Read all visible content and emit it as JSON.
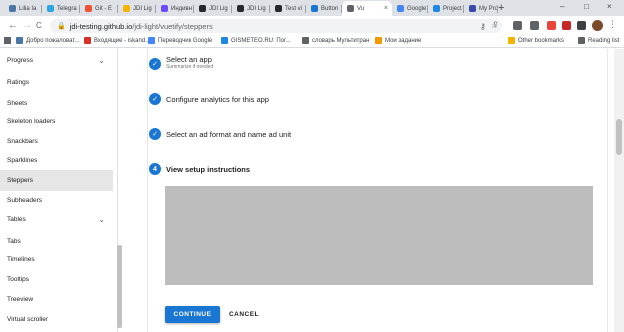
{
  "browser": {
    "tabs": [
      {
        "title": "Lilia Ia",
        "color": "#4a76a8"
      },
      {
        "title": "Telegra",
        "color": "#2ca5e0"
      },
      {
        "title": "Git - E",
        "color": "#f05133"
      },
      {
        "title": "JDI Lig",
        "color": "#f4b400"
      },
      {
        "title": "Индивн",
        "color": "#6d4aff"
      },
      {
        "title": "JDI Lig",
        "color": "#24292e"
      },
      {
        "title": "JDI Lig",
        "color": "#24292e"
      },
      {
        "title": "Test vi",
        "color": "#24292e"
      },
      {
        "title": "Button",
        "color": "#1976d2"
      },
      {
        "title": "Vu",
        "color": "#5f6368",
        "active": true
      },
      {
        "title": "Google",
        "color": "#4285f4"
      },
      {
        "title": "Project",
        "color": "#1e88e5"
      },
      {
        "title": "My Pro",
        "color": "#3949ab"
      }
    ],
    "new_tab": "+",
    "close": "×",
    "url_host": "jdi-testing.github.io",
    "url_path": "/jdi-light/vuetify/steppers",
    "back": "←",
    "forward": "→",
    "reload": "C",
    "lock": "🔒",
    "key_icon": "⚷",
    "share_icon": "⇪",
    "star_icon": "☆",
    "extensions": [
      "#5f6368",
      "#5f6368",
      "#e8453c",
      "#c62828",
      "#3c4043",
      "#5f6368"
    ],
    "win_min": "–",
    "win_max": "□",
    "win_close": "×",
    "menu": "⋮"
  },
  "bookmarks": [
    {
      "label": "Добро пожаловат...",
      "color": "#4a76a8"
    },
    {
      "label": "Входящие - iskand...",
      "color": "#d93025"
    },
    {
      "label": "Переводчик Google",
      "color": "#4285f4"
    },
    {
      "label": "GISMETEO.RU: Пог...",
      "color": "#1e88e5"
    },
    {
      "label": "словарь Мультитран",
      "color": "#5f6368"
    },
    {
      "label": "Мои задание",
      "color": "#f29900"
    },
    {
      "label": "Other bookmarks",
      "color": "#f4b400"
    },
    {
      "label": "Reading list",
      "color": "#5f6368"
    }
  ],
  "sidebar": {
    "items": [
      {
        "label": "Progress",
        "chevron": "⌄"
      },
      {
        "label": "Ratings"
      },
      {
        "label": "Sheets"
      },
      {
        "label": "Skeleton loaders"
      },
      {
        "label": "Snackbars"
      },
      {
        "label": "Sparklines"
      },
      {
        "label": "Steppers",
        "active": true
      },
      {
        "label": "Subheaders"
      },
      {
        "label": "Tables",
        "chevron": "⌄"
      },
      {
        "label": "Tabs"
      },
      {
        "label": "Timelines"
      },
      {
        "label": "Tooltips"
      },
      {
        "label": "Treeview"
      },
      {
        "label": "Virtual scroller"
      }
    ]
  },
  "stepper": {
    "steps": [
      {
        "icon": "✓",
        "title": "Select an app",
        "subtitle": "Summarize if needed",
        "complete": true
      },
      {
        "icon": "✓",
        "title": "Configure analytics for this app",
        "complete": true
      },
      {
        "icon": "✓",
        "title": "Select an ad format and name ad unit",
        "complete": true
      },
      {
        "icon": "4",
        "title": "View setup instructions",
        "active": true
      }
    ],
    "continue_label": "CONTINUE",
    "cancel_label": "CANCEL"
  },
  "colors": {
    "primary": "#1976d2",
    "placeholder": "#bdbdbd"
  }
}
